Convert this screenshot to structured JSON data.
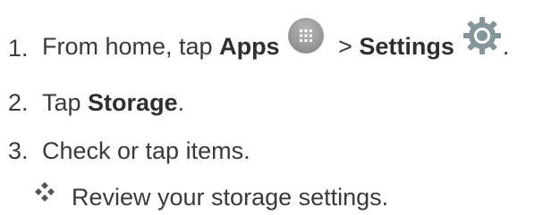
{
  "steps": [
    {
      "number": "1.",
      "pre": "From home, tap ",
      "bold1": "Apps",
      "mid": " > ",
      "bold2": "Settings",
      "post": ".",
      "icons": [
        "apps-grid-icon",
        "settings-gear-icon"
      ]
    },
    {
      "number": "2.",
      "pre": "Tap ",
      "bold1": "Storage",
      "post": "."
    },
    {
      "number": "3.",
      "text": "Check or tap items."
    }
  ],
  "note": {
    "icon": "diamond-bullet-icon",
    "text": "Review your storage settings."
  },
  "colors": {
    "text": "#3a3a3a",
    "apps_icon": "#9e9e9e",
    "settings_icon": "#7f8f93"
  }
}
